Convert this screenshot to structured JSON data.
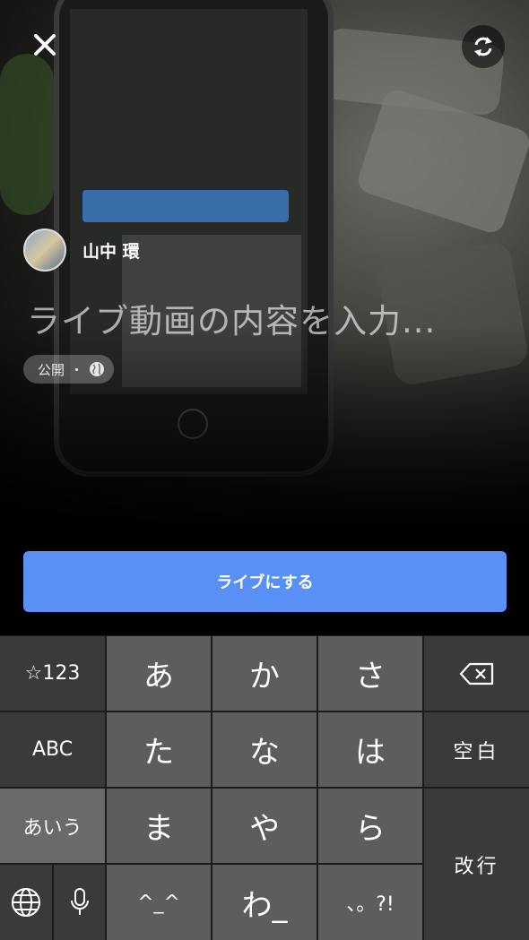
{
  "header": {
    "close_icon": "close-icon",
    "switch_camera_icon": "switch-camera-icon"
  },
  "author": {
    "name": "山中 環"
  },
  "composer": {
    "description_placeholder": "ライブ動画の内容を入力...",
    "privacy_label": "公開",
    "privacy_separator": "・",
    "privacy_icon": "globe-icon"
  },
  "live_button": {
    "label": "ライブにする",
    "color": "#5890f6"
  },
  "keyboard": {
    "row1": [
      "☆123",
      "あ",
      "か",
      "さ"
    ],
    "row2": [
      "ABC",
      "た",
      "な",
      "は",
      "空白"
    ],
    "row3": [
      "あいう",
      "ま",
      "や",
      "ら"
    ],
    "row4": [
      "^_^",
      "わ_",
      "、。?!"
    ],
    "return_label": "改行",
    "backspace_icon": "backspace-icon",
    "globe_icon": "globe-icon",
    "mic_icon": "microphone-icon"
  }
}
